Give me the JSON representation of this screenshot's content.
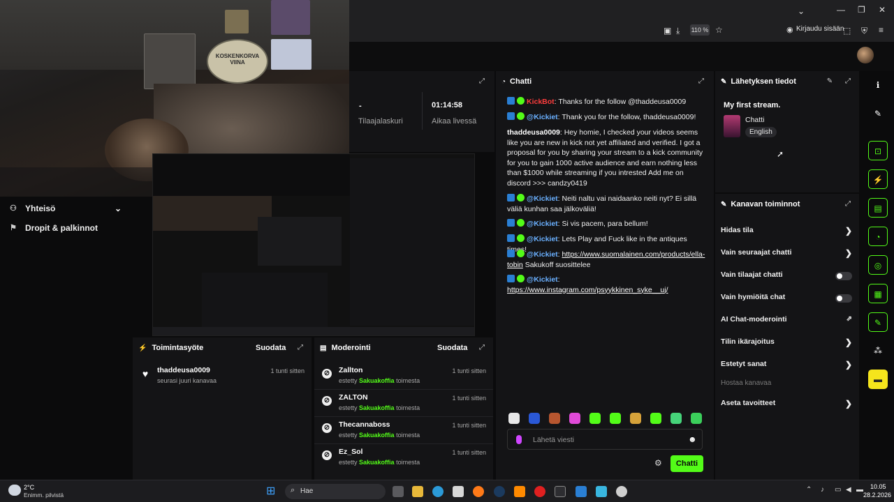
{
  "browser": {
    "zoom": "110 %",
    "login_label": "Kirjaudu sisään"
  },
  "webcam": {
    "badge_text": "KOSKENKORVA VIINA"
  },
  "leftnav": {
    "items": [
      {
        "label": "Yhteisö",
        "icon": "community-icon"
      },
      {
        "label": "Dropit & palkinnot",
        "icon": "drops-icon"
      }
    ]
  },
  "stats": {
    "subscribers_value": "-",
    "subscribers_label": "Tilaajalaskuri",
    "live_time_value": "01:14:58",
    "live_time_label": "Aikaa livessä"
  },
  "activity": {
    "title": "Toimintasyöte",
    "filter": "Suodata",
    "items": [
      {
        "name": "thaddeusa0009",
        "sub": "seurasi juuri kanavaa",
        "time": "1 tunti sitten"
      }
    ]
  },
  "moderation": {
    "title": "Moderointi",
    "filter": "Suodata",
    "items": [
      {
        "name": "Zallton",
        "pre": "estetty",
        "by": "Sakuakoffia",
        "post": "toimesta",
        "time": "1 tunti sitten"
      },
      {
        "name": "ZALTON",
        "pre": "estetty",
        "by": "Sakuakoffia",
        "post": "toimesta",
        "time": "1 tunti sitten"
      },
      {
        "name": "Thecannaboss",
        "pre": "estetty",
        "by": "Sakuakoffia",
        "post": "toimesta",
        "time": "1 tunti sitten"
      },
      {
        "name": "Ez_Sol",
        "pre": "estetty",
        "by": "Sakuakoffia",
        "post": "toimesta",
        "time": "1 tunti sitten"
      }
    ]
  },
  "chat": {
    "title": "Chatti",
    "messages": [
      {
        "user": "KickBot",
        "text": ": Thanks for the follow @thaddeusa0009"
      },
      {
        "user": "@Kickiet",
        "text": ": Thank you for the follow, thaddeusa0009!"
      },
      {
        "user": "thaddeusa0009",
        "text": ": Hey homie, I checked your videos seems like you are new in kick not yet affiliated and verified. I got a proposal for you by sharing your stream to a kick community for you to gain 1000 active audience and earn nothing less than $1000 while streaming if you intrested Add me on discord >>> candzy0419"
      },
      {
        "user": "@Kickiet",
        "text": ": Neiti naltu vai naidaanko neiti nyt? Ei sillä väliä kunhan saa jälkoväliä!"
      },
      {
        "user": "@Kickiet",
        "text": ": Si vis pacem, para bellum!"
      },
      {
        "user": "@Kickiet",
        "text": ": Lets Play and Fuck like in the antiques times!"
      },
      {
        "user": "@Kickiet",
        "link": "https://www.suomalainen.com/products/ella-tobin",
        "text": " Sakukoff suosittelee"
      },
      {
        "user": "@Kickiet",
        "link": "https://www.instagram.com/psyykkinen_syke__uj/",
        "text": ""
      }
    ],
    "input_placeholder": "Lähetä viesti",
    "send_label": "Chatti"
  },
  "broadcast_info": {
    "title": "Lähetyksen tiedot",
    "stream_title": "My first stream.",
    "category": "Chatti",
    "language": "English"
  },
  "channel_actions": {
    "title": "Kanavan toiminnot",
    "items": [
      {
        "label": "Hidas tila",
        "control": "chevron"
      },
      {
        "label": "Vain seuraajat chatti",
        "control": "chevron"
      },
      {
        "label": "Vain tilaajat chatti",
        "control": "toggle"
      },
      {
        "label": "Vain hymiöitä chat",
        "control": "toggle"
      },
      {
        "label": "AI Chat-moderointi",
        "control": "external"
      },
      {
        "label": "Tilin ikärajoitus",
        "control": "chevron"
      },
      {
        "label": "Estetyt sanat",
        "control": "chevron"
      },
      {
        "label": "Hostaa kanavaa",
        "control": "disabled"
      },
      {
        "label": "Aseta tavoitteet",
        "control": "chevron"
      }
    ]
  },
  "rail_icons": [
    "info-icon",
    "pencil-icon",
    "camera-icon",
    "lightning-icon",
    "notes-icon",
    "chat-icon",
    "broadcast-icon",
    "layout-icon",
    "wrench-icon",
    "apps-icon",
    "clapper-icon"
  ],
  "taskbar": {
    "weather_temp": "2°C",
    "weather_desc": "Enimm. pilvistä",
    "search_label": "Hae",
    "time": "10.05",
    "date": "28.2.2026"
  },
  "colors": {
    "accent": "#53fc18",
    "panel": "#141416",
    "background": "#0b0b0c"
  }
}
